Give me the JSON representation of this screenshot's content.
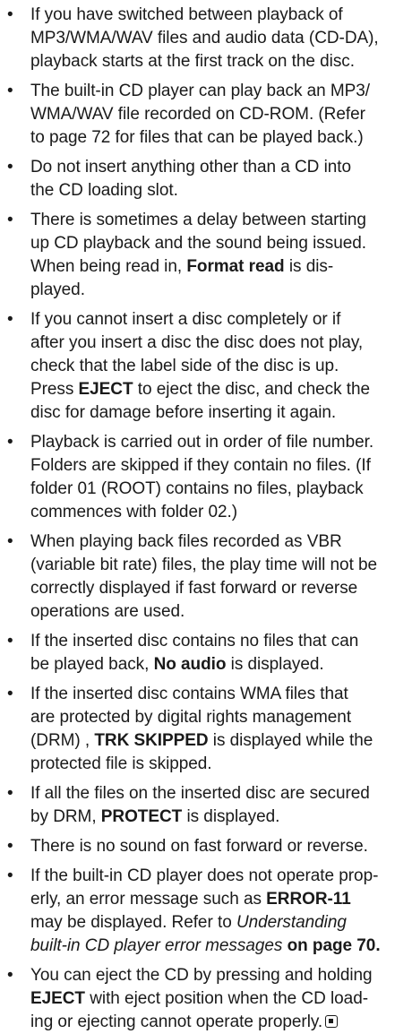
{
  "bullet_glyph": "•",
  "notes": [
    {
      "lines": [
        [
          "If you have switched between playback of"
        ],
        [
          "MP3/WMA/WAV files and audio data (CD-DA),"
        ],
        [
          "playback starts at the first track on the disc."
        ]
      ]
    },
    {
      "lines": [
        [
          "The built-in CD player can play back an MP3/"
        ],
        [
          "WMA/WAV file recorded on CD-ROM. (Refer"
        ],
        [
          "to page 72 for files that can be played back.)"
        ]
      ]
    },
    {
      "lines": [
        [
          "Do not insert anything other than a CD into"
        ],
        [
          "the CD loading slot."
        ]
      ]
    },
    {
      "lines": [
        [
          "There is sometimes a delay between starting"
        ],
        [
          "up CD playback and the sound being issued."
        ],
        [
          "When being read in, ",
          "Format read",
          " is dis-"
        ],
        [
          "played."
        ]
      ]
    },
    {
      "lines": [
        [
          "If you cannot insert a disc completely or if"
        ],
        [
          "after you insert a disc the disc does not play,"
        ],
        [
          "check that the label side of the disc is up."
        ],
        [
          "Press ",
          "EJECT",
          " to eject the disc, and check the"
        ],
        [
          "disc for damage before inserting it again."
        ]
      ]
    },
    {
      "lines": [
        [
          "Playback is carried out in order of file number."
        ],
        [
          "Folders are skipped if they contain no files. (If"
        ],
        [
          "folder 01 (ROOT) contains no files, playback"
        ],
        [
          "commences with folder 02.)"
        ]
      ]
    },
    {
      "lines": [
        [
          "When playing back files recorded as VBR"
        ],
        [
          "(variable bit rate) files, the play time will not be"
        ],
        [
          "correctly displayed if fast forward or reverse"
        ],
        [
          "operations are used."
        ]
      ]
    },
    {
      "lines": [
        [
          "If the inserted disc contains no files that can"
        ],
        [
          "be played back, ",
          "No audio",
          " is displayed."
        ]
      ]
    },
    {
      "lines": [
        [
          "If the inserted disc contains WMA files that"
        ],
        [
          "are protected by digital rights management"
        ],
        [
          "(DRM) , ",
          "TRK SKIPPED",
          " is displayed while the"
        ],
        [
          "protected file is skipped."
        ]
      ]
    },
    {
      "lines": [
        [
          "If all the files on the inserted disc are secured"
        ],
        [
          "by DRM, ",
          "PROTECT",
          " is displayed."
        ]
      ]
    },
    {
      "lines": [
        [
          "There is no sound on fast forward or reverse."
        ]
      ]
    },
    {
      "lines": [
        [
          "If the built-in CD player does not operate prop-"
        ],
        [
          "erly, an error message such as ",
          "ERROR-11"
        ],
        [
          "may be displayed. Refer to ",
          "Understanding"
        ],
        [
          "built-in CD player error messages",
          " on page 70."
        ]
      ],
      "italic_segments": [
        [
          2,
          1
        ],
        [
          3,
          0
        ]
      ]
    },
    {
      "lines": [
        [
          "You can eject the CD by pressing and holding"
        ],
        [
          "EJECT",
          " with eject position when the CD load-"
        ],
        [
          "ing or ejecting cannot operate properly."
        ]
      ],
      "bold_segments": [
        [
          1,
          0
        ]
      ],
      "end_mark": true
    }
  ]
}
